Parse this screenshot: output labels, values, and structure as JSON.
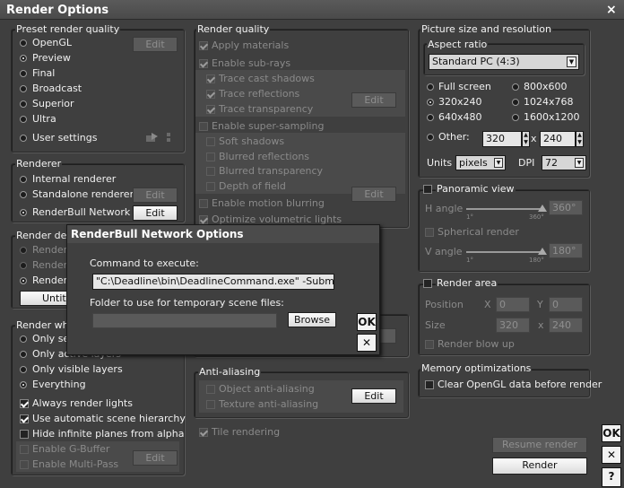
{
  "window": {
    "title": "Render Options",
    "close": "×"
  },
  "preset": {
    "title": "Preset render quality",
    "items": [
      "OpenGL",
      "Preview",
      "Final",
      "Broadcast",
      "Superior",
      "Ultra",
      "User settings"
    ],
    "selected": 1,
    "edit": "Edit"
  },
  "renderer": {
    "title": "Renderer",
    "items": [
      "Internal renderer",
      "Standalone renderer",
      "RenderBull Network"
    ],
    "selected": 2,
    "edit": "Edit"
  },
  "render_dest": {
    "title": "Render des",
    "items": [
      "Render",
      "Render",
      "Render"
    ],
    "untitled": "Untitle"
  },
  "render_what": {
    "title": "Render wha",
    "radios": [
      "Only sel",
      "Only active layers",
      "Only visible layers",
      "Everything"
    ],
    "selected": 3,
    "checks": [
      {
        "label": "Always render lights",
        "checked": true
      },
      {
        "label": "Use automatic scene hierarchy",
        "checked": true
      },
      {
        "label": "Hide infinite planes from alpha",
        "checked": false
      }
    ],
    "gbuffer": "Enable G-Buffer",
    "multipass": "Enable Multi-Pass",
    "edit": "Edit"
  },
  "quality": {
    "title": "Render quality",
    "apply": "Apply materials",
    "subrays": "Enable sub-rays",
    "shadows": "Trace cast shadows",
    "reflections": "Trace reflections",
    "transparency": "Trace transparency",
    "supersampling": "Enable super-sampling",
    "soft": "Soft shadows",
    "blurref": "Blurred reflections",
    "blurtrans": "Blurred transparency",
    "dof": "Depth of field",
    "motion": "Enable motion blurring",
    "volumetric": "Optimize volumetric lights",
    "edit": "Edit"
  },
  "aa": {
    "title": "Anti-aliasing",
    "object": "Object anti-aliasing",
    "texture": "Texture anti-aliasing",
    "edit": "Edit"
  },
  "tile": "Tile rendering",
  "picture": {
    "title": "Picture size and resolution",
    "aspect_title": "Aspect ratio",
    "aspect": "Standard PC (4:3)",
    "sizes": [
      "Full screen",
      "800x600",
      "320x240",
      "1024x768",
      "640x480",
      "1600x1200"
    ],
    "selected": 2,
    "other": "Other:",
    "w": "320",
    "x": "x",
    "h": "240",
    "units_label": "Units",
    "units": "pixels",
    "dpi_label": "DPI",
    "dpi": "72"
  },
  "pano": {
    "title": "Panoramic view",
    "h": "H angle",
    "hval": "360°",
    "h0": "1°",
    "h1": "360°",
    "spherical": "Spherical render",
    "v": "V angle",
    "vval": "180°",
    "v0": "1°",
    "v1": "180°"
  },
  "area": {
    "title": "Render area",
    "position": "Position",
    "X": "X",
    "x": "0",
    "Y": "Y",
    "y": "0",
    "size": "Size",
    "w": "320",
    "times": "x",
    "h": "240",
    "blowup": "Render blow up"
  },
  "memory": {
    "title": "Memory optimizations",
    "clear": "Clear OpenGL data before render"
  },
  "buttons": {
    "resume": "Resume render",
    "render": "Render",
    "ok": "OK",
    "cancel": "✕",
    "help": "?"
  },
  "dialog": {
    "title": "RenderBull Network Options",
    "cmd_label": "Command to execute:",
    "cmd": "\"C:\\Deadline\\bin\\DeadlineCommand.exe\" -SubmitVueJ",
    "folder_label": "Folder to use for temporary scene files:",
    "folder": "",
    "browse": "Browse",
    "ok": "OK",
    "cancel": "✕"
  }
}
